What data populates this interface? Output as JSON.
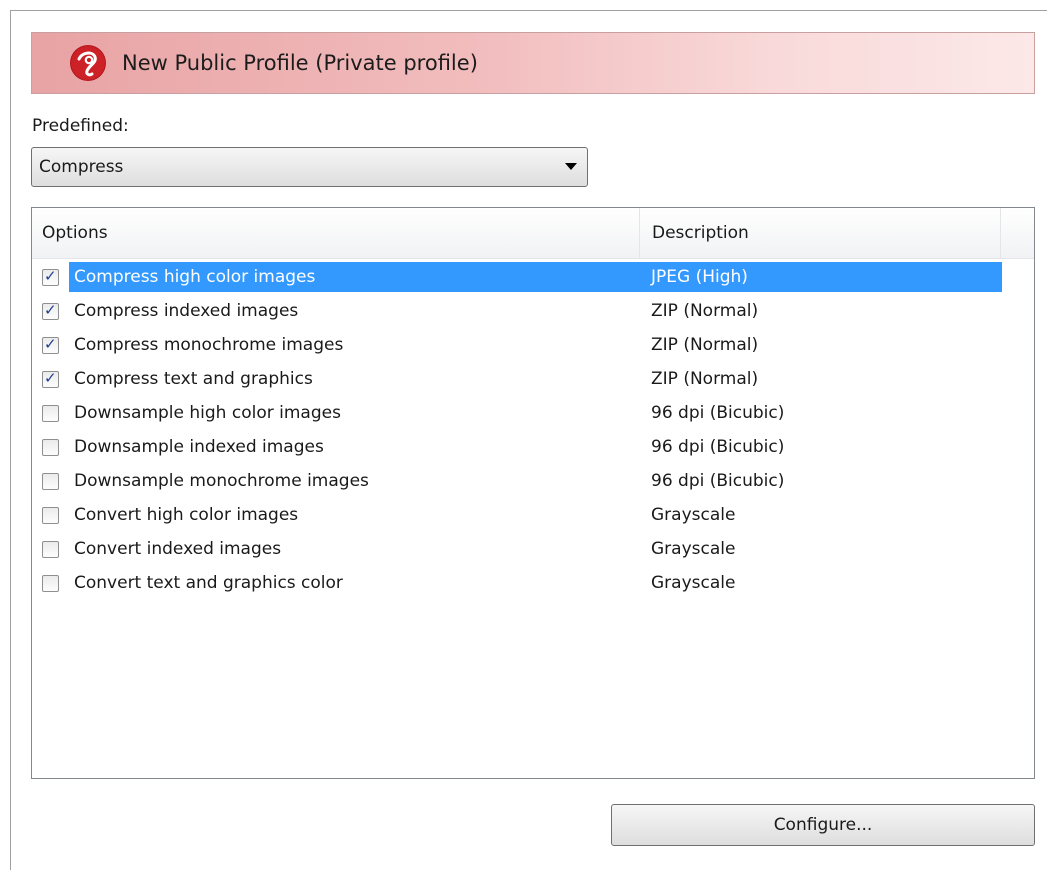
{
  "header": {
    "title": "New Public Profile (Private profile)",
    "logo_icon": "pdf-profile-logo-icon",
    "accent_color": "#c9191e"
  },
  "predefined": {
    "label": "Predefined:",
    "selected": "Compress"
  },
  "options_list": {
    "columns": [
      "Options",
      "Description"
    ],
    "rows": [
      {
        "option": "Compress high color images",
        "description": "JPEG (High)",
        "checked": true,
        "selected": true
      },
      {
        "option": "Compress indexed images",
        "description": "ZIP (Normal)",
        "checked": true,
        "selected": false
      },
      {
        "option": "Compress monochrome images",
        "description": "ZIP (Normal)",
        "checked": true,
        "selected": false
      },
      {
        "option": "Compress text and graphics",
        "description": "ZIP (Normal)",
        "checked": true,
        "selected": false
      },
      {
        "option": "Downsample high color images",
        "description": "96 dpi (Bicubic)",
        "checked": false,
        "selected": false
      },
      {
        "option": "Downsample indexed images",
        "description": "96 dpi (Bicubic)",
        "checked": false,
        "selected": false
      },
      {
        "option": "Downsample monochrome images",
        "description": "96 dpi (Bicubic)",
        "checked": false,
        "selected": false
      },
      {
        "option": "Convert high color images",
        "description": "Grayscale",
        "checked": false,
        "selected": false
      },
      {
        "option": "Convert indexed images",
        "description": "Grayscale",
        "checked": false,
        "selected": false
      },
      {
        "option": "Convert text and graphics color",
        "description": "Grayscale",
        "checked": false,
        "selected": false
      }
    ]
  },
  "buttons": {
    "configure_label": "Configure..."
  }
}
